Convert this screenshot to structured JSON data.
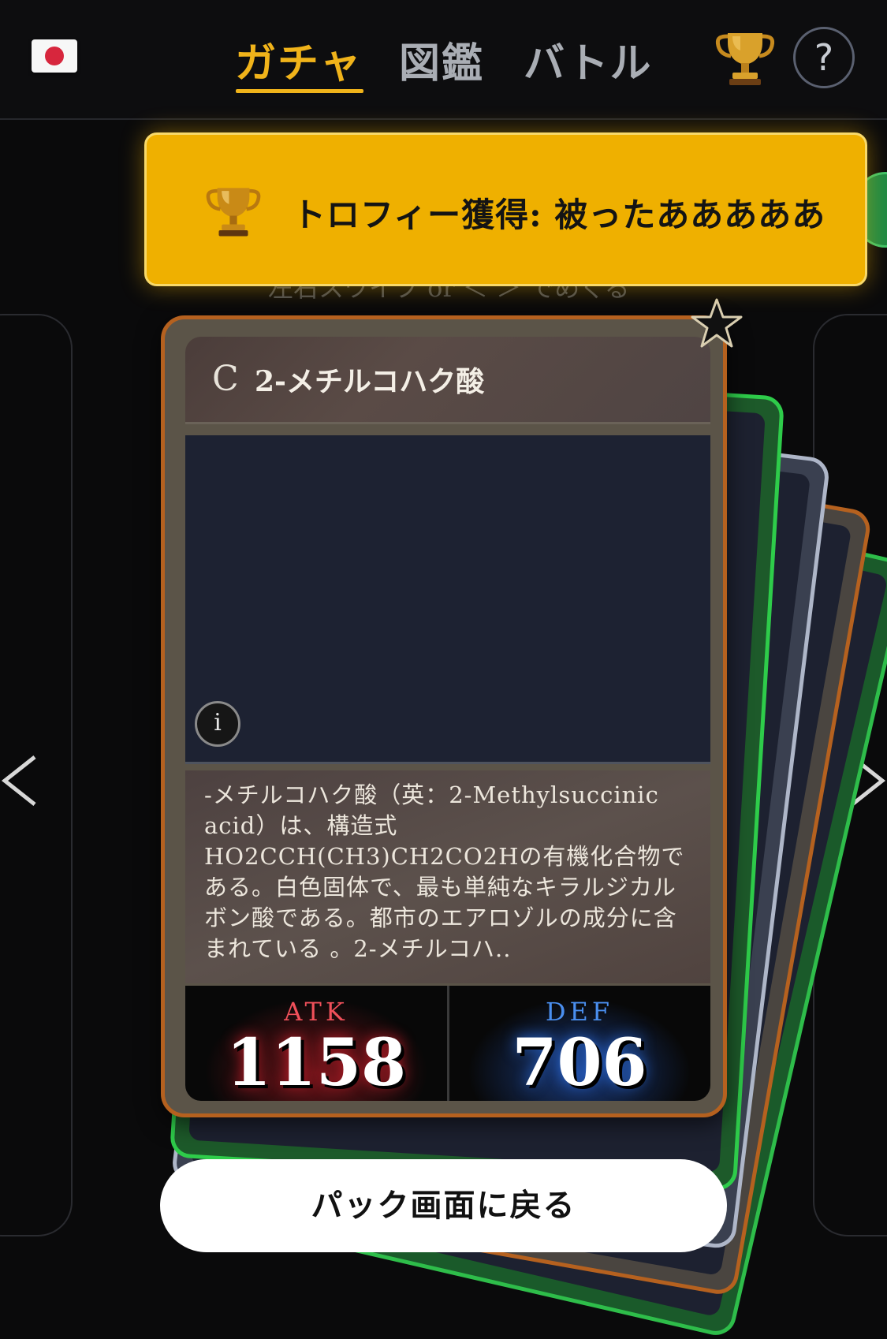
{
  "header": {
    "tabs": [
      {
        "label": "ガチャ",
        "active": true
      },
      {
        "label": "図鑑",
        "active": false
      },
      {
        "label": "バトル",
        "active": false
      }
    ],
    "help_label": "?",
    "flag_icon": "japan-flag-icon",
    "trophy_icon": "trophy-icon"
  },
  "hint": "左右スワイプ or ＜ ＞ でめくる",
  "toast": {
    "text": "トロフィー獲得: 被ったあああああ",
    "icon": "trophy-icon",
    "color": "#efb000"
  },
  "card": {
    "rarity": "C",
    "name": "2-メチルコハク酸",
    "info_label": "i",
    "description": "-メチルコハク酸（英：2-Methylsuccinic acid）は、構造式HO2CCH(CH3)CH2CO2Hの有機化合物である。白色固体で、最も単純なキラルジカルボン酸である。都市のエアロゾルの成分に含まれている 。2-メチルコハ..",
    "atk_label": "ATK",
    "atk": "1158",
    "def_label": "DEF",
    "def": "706",
    "frame_color": "#b5611f"
  },
  "nav": {
    "prev": "<",
    "next": ">"
  },
  "back_button": "パック画面に戻る"
}
